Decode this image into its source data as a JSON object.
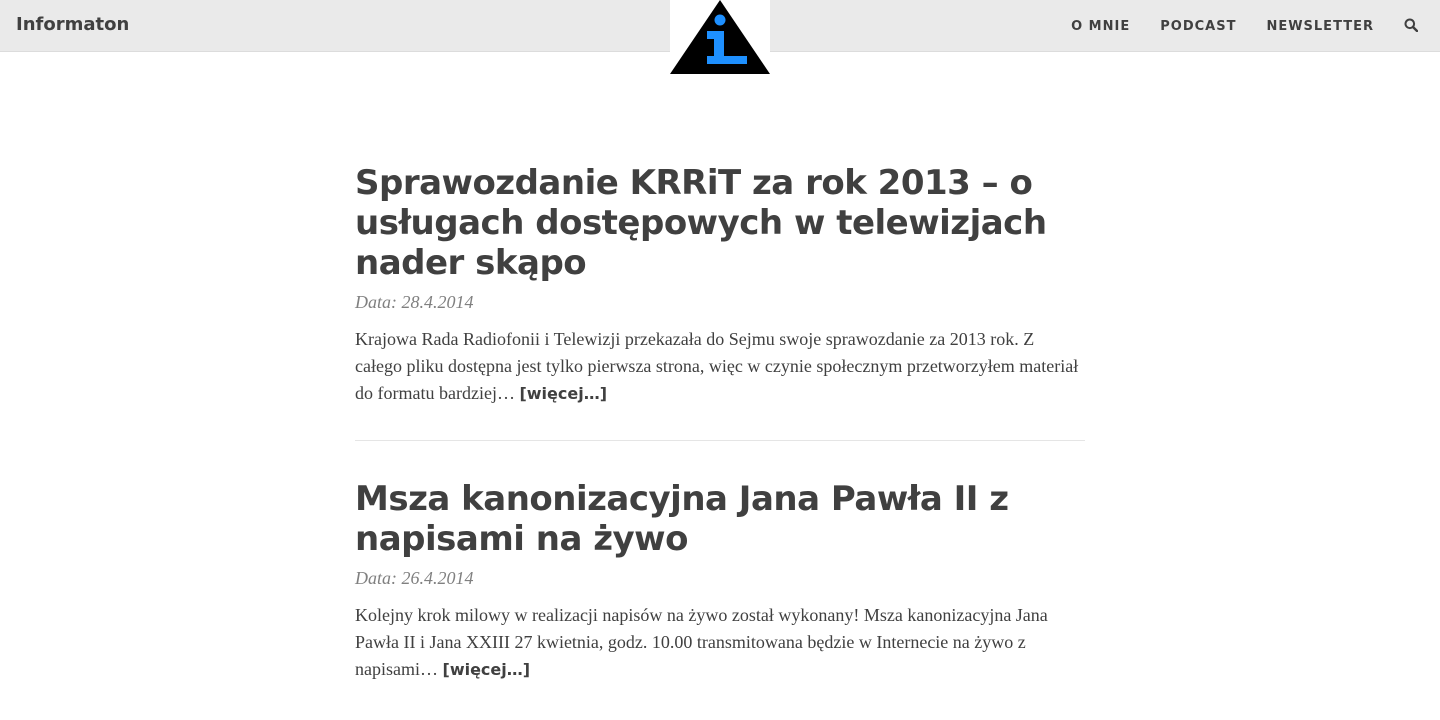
{
  "header": {
    "brand": "Informaton",
    "logo_letter": "i",
    "nav": [
      {
        "label": "O MNIE"
      },
      {
        "label": "PODCAST"
      },
      {
        "label": "NEWSLETTER"
      }
    ],
    "search_icon": "search-icon"
  },
  "posts": [
    {
      "title": "Sprawozdanie KRRiT za rok 2013 – o usługach dostępowych w telewizjach nader skąpo",
      "date": "Data: 28.4.2014",
      "excerpt": "Krajowa Rada Radiofonii i Telewizji przekazała do Sejmu swoje sprawozdanie za 2013 rok. Z całego pliku dostępna jest tylko pierwsza strona, więc w czynie społecznym przetworzyłem materiał do formatu bardziej… ",
      "more": "[więcej…]"
    },
    {
      "title": "Msza kanonizacyjna Jana Pawła II z napisami na żywo",
      "date": "Data: 26.4.2014",
      "excerpt": "Kolejny krok milowy w realizacji napisów na żywo został wykonany! Msza kanonizacyjna Jana Pawła II i Jana XXIII 27 kwietnia, godz. 10.00 transmitowana będzie w Internecie na żywo z napisami… ",
      "more": "[więcej…]"
    }
  ],
  "colors": {
    "header_bg": "#eaeaea",
    "text": "#404040",
    "date": "#808080",
    "logo_triangle": "#000000",
    "logo_letter": "#1e90ff"
  }
}
